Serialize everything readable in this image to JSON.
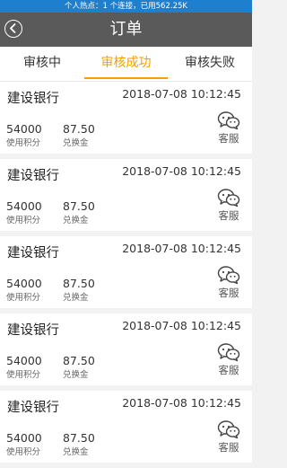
{
  "status_bar": {
    "text": "个人热点：1 个连接，已用562.25K"
  },
  "nav": {
    "title": "订单",
    "back_icon": "chevron-left-circle-icon"
  },
  "tabs": [
    {
      "label": "审核中",
      "active": false
    },
    {
      "label": "审核成功",
      "active": true
    },
    {
      "label": "审核失败",
      "active": false
    }
  ],
  "colors": {
    "accent": "#f0a000",
    "navbar": "#5a5a5a",
    "status_bar": "#1e7fcf"
  },
  "orders": [
    {
      "bank": "建设银行",
      "time": "2018-07-08 10:12:45",
      "points": "54000",
      "points_label": "使用积分",
      "gold": "87.50",
      "gold_label": "兑换金",
      "service_label": "客服",
      "service_icon": "wechat-icon"
    },
    {
      "bank": "建设银行",
      "time": "2018-07-08 10:12:45",
      "points": "54000",
      "points_label": "使用积分",
      "gold": "87.50",
      "gold_label": "兑换金",
      "service_label": "客服",
      "service_icon": "wechat-icon"
    },
    {
      "bank": "建设银行",
      "time": "2018-07-08 10:12:45",
      "points": "54000",
      "points_label": "使用积分",
      "gold": "87.50",
      "gold_label": "兑换金",
      "service_label": "客服",
      "service_icon": "wechat-icon"
    },
    {
      "bank": "建设银行",
      "time": "2018-07-08 10:12:45",
      "points": "54000",
      "points_label": "使用积分",
      "gold": "87.50",
      "gold_label": "兑换金",
      "service_label": "客服",
      "service_icon": "wechat-icon"
    },
    {
      "bank": "建设银行",
      "time": "2018-07-08 10:12:45",
      "points": "54000",
      "points_label": "使用积分",
      "gold": "87.50",
      "gold_label": "兑换金",
      "service_label": "客服",
      "service_icon": "wechat-icon"
    }
  ]
}
